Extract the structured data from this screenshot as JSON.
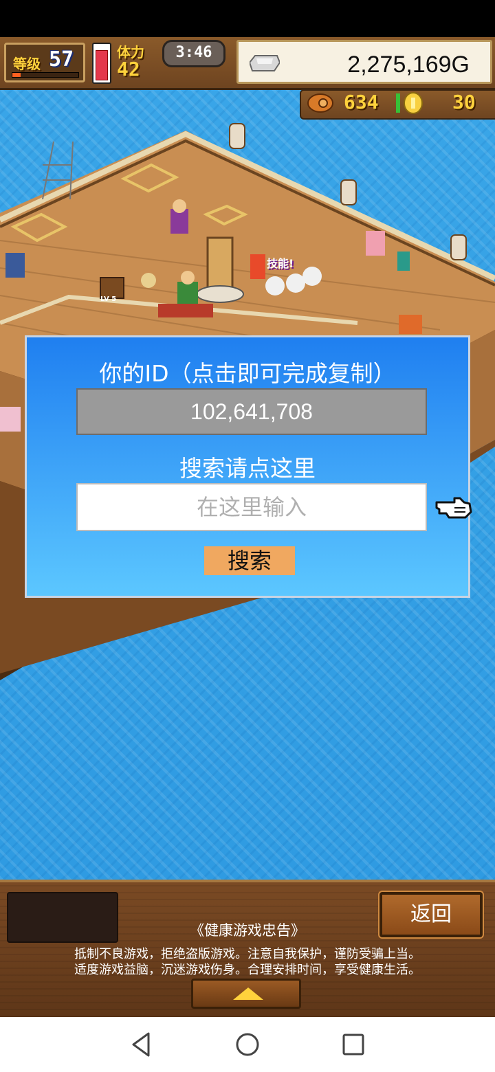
{
  "hud": {
    "level_label": "等级",
    "level": "57",
    "level_exp_fraction": 0.12,
    "stamina_label": "体力",
    "stamina": "42",
    "stamina_fraction": 0.85,
    "timer": "3:46",
    "gold": "2,275,169G",
    "resource_1_value": "634",
    "resource_1_icon": "wood-icon",
    "resource_2_value": "30",
    "resource_2_icon": "coin-icon"
  },
  "scene": {
    "popup_text": "技能!",
    "chest_label": "LV 5"
  },
  "dialog": {
    "title": "你的ID（点击即可完成复制）",
    "id_value": "102,641,708",
    "search_prompt": "搜索请点这里",
    "input_placeholder": "在这里输入",
    "search_button": "搜索"
  },
  "bottom": {
    "back_button": "返回",
    "notice_title": "《健康游戏忠告》",
    "notice_line_1": "抵制不良游戏，拒绝盗版游戏。注意自我保护，谨防受骗上当。",
    "notice_line_2": "适度游戏益脑，沉迷游戏伤身。合理安排时间，享受健康生活。"
  },
  "colors": {
    "dialog_top": "#1f7ff0",
    "dialog_bottom": "#5cc7ff",
    "search_button": "#f0a860",
    "hud_gold_text": "#ffd23c",
    "ocean": "#3aa6e8"
  }
}
